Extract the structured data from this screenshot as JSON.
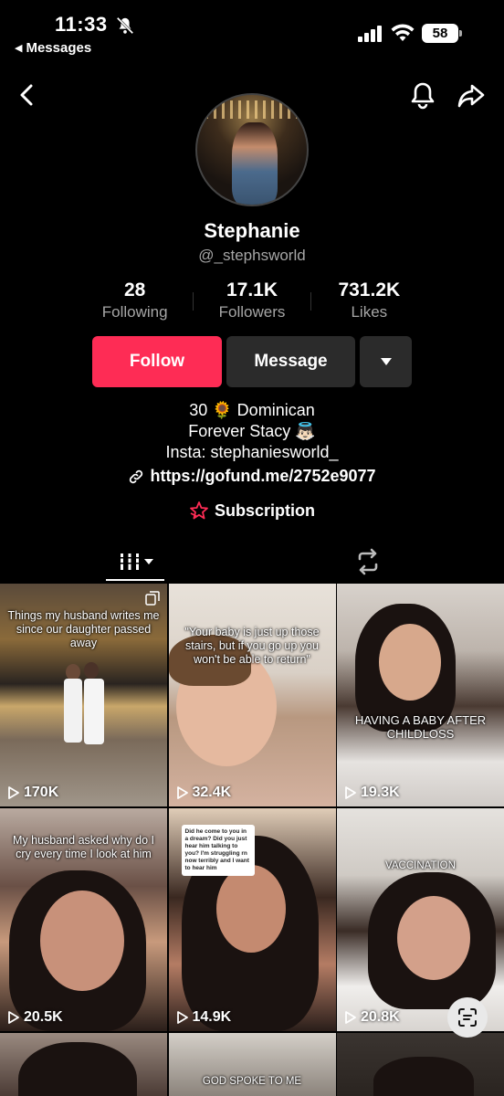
{
  "status_bar": {
    "time": "11:33",
    "back_app": "Messages",
    "battery": "58"
  },
  "profile": {
    "display_name": "Stephanie",
    "username": "@_stephsworld",
    "stats": [
      {
        "value": "28",
        "label": "Following"
      },
      {
        "value": "17.1K",
        "label": "Followers"
      },
      {
        "value": "731.2K",
        "label": "Likes"
      }
    ],
    "follow_label": "Follow",
    "message_label": "Message",
    "bio": [
      "30 🌻 Dominican",
      "Forever Stacy 👼🏻",
      "Insta: stephaniesworld_"
    ],
    "link": "https://gofund.me/2752e9077",
    "subscription_label": "Subscription"
  },
  "colors": {
    "accent": "#fe2c55",
    "secondary_button": "#2b2b2b",
    "muted_text": "#a6a6a6"
  },
  "videos": [
    {
      "caption": "Things my husband writes me since our daughter passed away",
      "views": "170K"
    },
    {
      "caption": "\"Your baby is just up those stairs, but if you go up you won't be able to return\"",
      "views": "32.4K"
    },
    {
      "caption": "HAVING A BABY AFTER CHILDLOSS",
      "views": "19.3K"
    },
    {
      "caption": "My husband asked why do I cry every time I look at him",
      "views": "20.5K"
    },
    {
      "caption": "Did he come to you in a dream? Did you just hear him talking to you? I'm struggling rn now terribly and I want to hear him",
      "views": "14.9K"
    },
    {
      "caption": "VACCINATION",
      "views": "20.8K"
    },
    {
      "caption": "",
      "views": ""
    },
    {
      "caption": "GOD SPOKE TO ME",
      "views": ""
    },
    {
      "caption": "",
      "views": ""
    }
  ]
}
